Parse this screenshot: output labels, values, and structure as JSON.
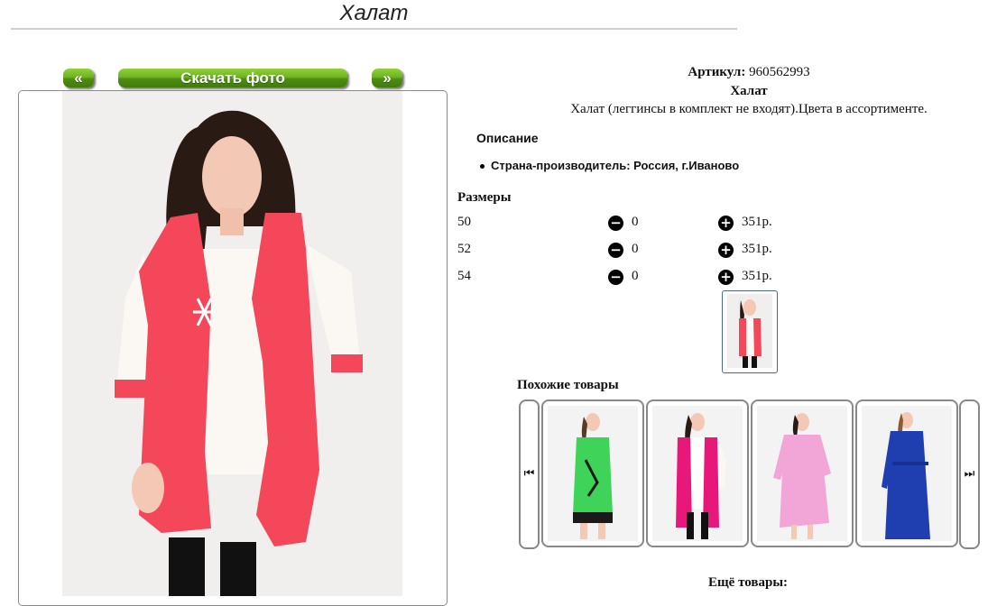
{
  "page": {
    "title": "Халат"
  },
  "gallery": {
    "prev_label": "«",
    "download_label": "Скачать фото",
    "next_label": "»"
  },
  "product": {
    "article_label": "Артикул:",
    "article_value": "960562993",
    "name": "Халат",
    "description": "Халат (леггинсы в комплект не входят).Цвета в ассортименте.",
    "details_heading": "Описание",
    "details": [
      "Страна-производитель: Россия, г.Иваново"
    ]
  },
  "sizes": {
    "heading": "Размеры",
    "rows": [
      {
        "size": "50",
        "qty": "0",
        "price": "351р."
      },
      {
        "size": "52",
        "qty": "0",
        "price": "351р."
      },
      {
        "size": "54",
        "qty": "0",
        "price": "351р."
      }
    ],
    "minus_icon": "minus-circle-icon",
    "plus_icon": "plus-circle-icon"
  },
  "similar": {
    "heading": "Похожие товары",
    "prev_icon": "skip-back-icon",
    "next_icon": "skip-forward-icon",
    "prev_glyph": "⏮",
    "next_glyph": "⏭",
    "items": [
      {
        "color": "#3fd35a",
        "accent": "#1a1a1a"
      },
      {
        "color": "#e8177a",
        "accent": "#ffffff"
      },
      {
        "color": "#f2a6d8",
        "accent": "#f2a6d8"
      },
      {
        "color": "#1f3fb0",
        "accent": "#1f3fb0"
      }
    ]
  },
  "more": {
    "heading": "Ещё товары:"
  },
  "colors": {
    "button_green": "#5ea31b",
    "robe_coral": "#f4475a",
    "sleeve_white": "#fbf8f3",
    "frame_border": "#8a8a8a"
  }
}
